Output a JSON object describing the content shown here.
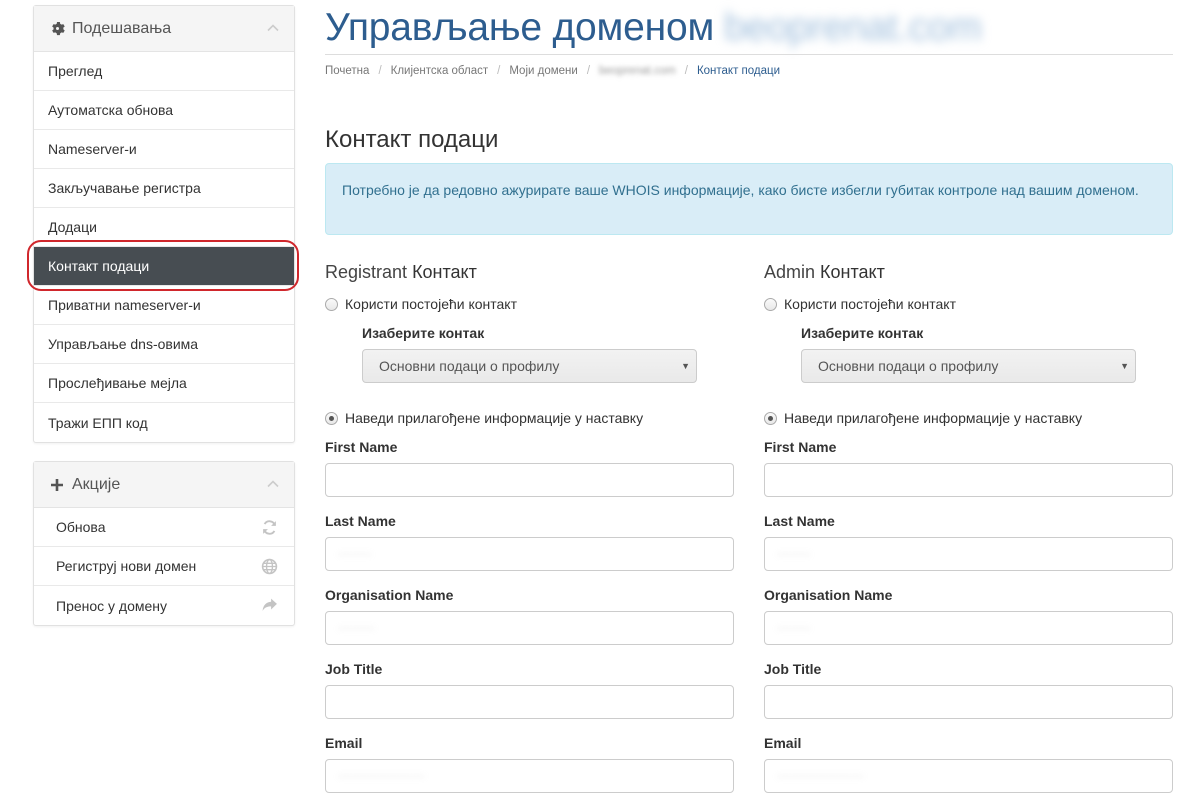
{
  "settings_panel": {
    "title": "Подешавања",
    "items": [
      {
        "label": "Преглед"
      },
      {
        "label": "Аутоматска обнова"
      },
      {
        "label": "Nameserver-и"
      },
      {
        "label": "Закључавање регистра"
      },
      {
        "label": "Додаци"
      },
      {
        "label": "Контакт подаци",
        "active": true
      },
      {
        "label": "Приватни nameserver-и"
      },
      {
        "label": "Управљање dns-овима"
      },
      {
        "label": "Прослеђивање мејла"
      },
      {
        "label": "Тражи ЕПП код"
      }
    ]
  },
  "actions_panel": {
    "title": "Акције",
    "items": [
      {
        "label": "Обнова",
        "icon": "refresh-icon"
      },
      {
        "label": "Региструј нови домен",
        "icon": "globe-icon"
      },
      {
        "label": "Пренос у домену",
        "icon": "share-arrow-icon"
      }
    ]
  },
  "header": {
    "title": "Управљање доменом",
    "domain_blurred": "beoprenat.com"
  },
  "breadcrumb": [
    {
      "label": "Почетна"
    },
    {
      "label": "Клијентска област"
    },
    {
      "label": "Моји домени"
    },
    {
      "label": "beoprenat.com",
      "blurred": true
    },
    {
      "label": "Контакт подаци",
      "current": true
    }
  ],
  "section_title": "Контакт подаци",
  "alert_text": "Потребно је да редовно ажурирате ваше WHOIS информације, како бисте избегли губитак контроле над вашим доменом.",
  "registrant": {
    "title_light": "Registrant",
    "title_main": "Контакт",
    "use_existing_label": "Користи постојећи контакт",
    "choose_contact_label": "Изаберите контак",
    "select_value": "Основни подаци о профилу",
    "custom_label": "Наведи прилагођене информације у наставку",
    "fields": [
      {
        "label": "First Name",
        "value": ""
      },
      {
        "label": "Last Name",
        "value": "··········"
      },
      {
        "label": "Organisation Name",
        "value": "···········"
      },
      {
        "label": "Job Title",
        "value": ""
      },
      {
        "label": "Email",
        "value": "··························"
      }
    ]
  },
  "admin": {
    "title_light": "Admin",
    "title_main": "Контакт",
    "use_existing_label": "Користи постојећи контакт",
    "choose_contact_label": "Изаберите контак",
    "select_value": "Основни подаци о профилу",
    "custom_label": "Наведи прилагођене информације у наставку",
    "fields": [
      {
        "label": "First Name",
        "value": ""
      },
      {
        "label": "Last Name",
        "value": "··········"
      },
      {
        "label": "Organisation Name",
        "value": "··········"
      },
      {
        "label": "Job Title",
        "value": ""
      },
      {
        "label": "Email",
        "value": "··························"
      }
    ]
  },
  "colors": {
    "accent": "#2d5d8f",
    "active_menu_bg": "#474d52",
    "alert_bg": "#d9edf7",
    "alert_text": "#31708f",
    "highlight_ring": "#d0272c"
  }
}
